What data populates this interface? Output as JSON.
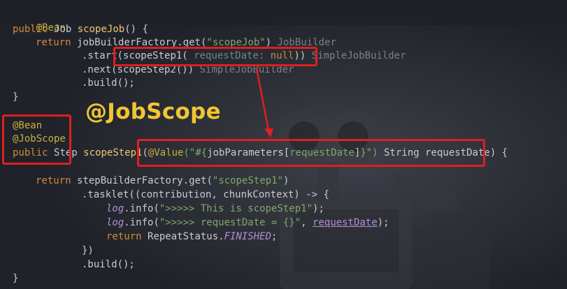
{
  "code": {
    "line1": {
      "annotation": "@Bean"
    },
    "line2": {
      "kw": "public",
      "type": "Job",
      "method": "scopeJob",
      "rest": "() {"
    },
    "line3": {
      "kw": "return",
      "plain": "jobBuilderFactory.get(",
      "str": "\"scopeJob\"",
      "close": ")",
      "hint": "JobBuilder"
    },
    "line4": {
      "plain": ".start(",
      "call": "scopeStep1(",
      "hint_param": "requestDate:",
      "value": "null",
      "close": "))",
      "hint": "SimpleJobBuilder"
    },
    "line5": {
      "plain": ".next(scopeStep2())",
      "hint": "SimpleJobBuilder"
    },
    "line6": {
      "plain": ".build();"
    },
    "line7": {
      "plain": "}"
    },
    "line8": {
      "annotation": "@Bean"
    },
    "line9": {
      "annotation": "@JobScope"
    },
    "line10": {
      "kw": "public",
      "type": "Step",
      "method": "scopeStep1",
      "open": "(",
      "annotation": "@Value",
      "str_open": "(\"#{",
      "param_expr": "jobParameters[",
      "param_key": "requestDate",
      "param_close": "]",
      "str_close": "}\")",
      "rest": " String requestDate)",
      "brace": " {"
    },
    "line11": {
      "kw": "return",
      "plain": "stepBuilderFactory.get(",
      "str": "\"scopeStep1\"",
      "close": ")"
    },
    "line12": {
      "plain": ".tasklet((contribution, chunkContext) -> {"
    },
    "line13": {
      "log": "log",
      "plain": ".info(",
      "str": "\">>>>> This is scopeStep1\"",
      "close": ");"
    },
    "line14": {
      "log": "log",
      "plain": ".info(",
      "str": "\">>>>> requestDate = {}\"",
      "comma": ", ",
      "var": "requestDate",
      "close": ");"
    },
    "line15": {
      "kw": "return",
      "plain": "RepeatStatus.",
      "const": "FINISHED",
      "close": ";"
    },
    "line16": {
      "plain": "})"
    },
    "line17": {
      "plain": ".build();"
    },
    "line18": {
      "plain": "}"
    }
  },
  "overlay_title": "@JobScope",
  "colors": {
    "highlight": "#e21e1e",
    "title": "#f2c531"
  }
}
